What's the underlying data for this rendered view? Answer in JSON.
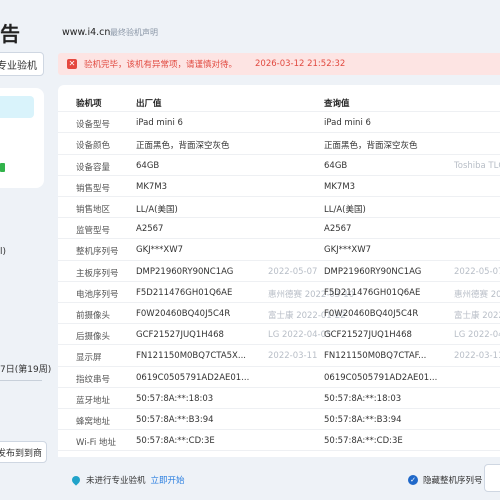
{
  "left": {
    "title_char": "告",
    "pro_button": "专业验机",
    "text_1": "l)",
    "text_2": "7日(第19周)",
    "bottom_button": "发布到到商"
  },
  "header": {
    "site": "www.i4.cn",
    "disclaimer": "最终验机声明"
  },
  "alert": {
    "message": "验机完毕，该机有异常项，请谨慎对待。",
    "time": "2026-03-12 21:52:32",
    "color": "#e14a40"
  },
  "table": {
    "headers": {
      "label": "验机项",
      "factory": "出厂值",
      "query": "查询值"
    },
    "rows": [
      {
        "label": "设备型号",
        "factory": "iPad mini 6",
        "fdate": "",
        "query": "iPad mini 6",
        "qdate": ""
      },
      {
        "label": "设备颜色",
        "factory": "正面黑色，背面深空灰色",
        "fdate": "",
        "query": "正面黑色，背面深空灰色",
        "qdate": ""
      },
      {
        "label": "设备容量",
        "factory": "64GB",
        "fdate": "",
        "query": "64GB",
        "qdate": "Toshiba TLC"
      },
      {
        "label": "销售型号",
        "factory": "MK7M3",
        "fdate": "",
        "query": "MK7M3",
        "qdate": ""
      },
      {
        "label": "销售地区",
        "factory": "LL/A(美国)",
        "fdate": "",
        "query": "LL/A(美国)",
        "qdate": ""
      },
      {
        "label": "监管型号",
        "factory": "A2567",
        "fdate": "",
        "query": "A2567",
        "qdate": ""
      },
      {
        "label": "整机序列号",
        "factory": "GKJ***XW7",
        "fdate": "",
        "query": "GKJ***XW7",
        "qdate": ""
      },
      {
        "label": "主板序列号",
        "factory": "DMP21960RY90NC1AG",
        "fdate": "2022-05-07",
        "query": "DMP21960RY90NC1AG",
        "qdate": "2022-05-07"
      },
      {
        "label": "电池序列号",
        "factory": "F5D211476GH01Q6AE",
        "fdate": "惠州德赛 2022-03-10",
        "query": "F5D211476GH01Q6AE",
        "qdate": "惠州德赛 2022-03-10"
      },
      {
        "label": "前摄像头",
        "factory": "F0W20460BQ40J5C4R",
        "fdate": "富士康 2022-01-22",
        "query": "F0W20460BQ40J5C4R",
        "qdate": "富士康 2022-01-22"
      },
      {
        "label": "后摄像头",
        "factory": "GCF21527JUQ1H468",
        "fdate": "LG 2022-04-05",
        "query": "GCF21527JUQ1H468",
        "qdate": "LG 2022-04-05"
      },
      {
        "label": "显示屏",
        "factory": "FN121150M0BQ7CTA5X...",
        "fdate": "2022-03-11",
        "query": "FN121150M0BQ7CTAF...",
        "qdate": "2022-03-11"
      },
      {
        "label": "指纹串号",
        "factory": "0619C0505791AD2AE01...",
        "fdate": "",
        "query": "0619C0505791AD2AE01...",
        "qdate": ""
      },
      {
        "label": "蓝牙地址",
        "factory": "50:57:8A:**:18:03",
        "fdate": "",
        "query": "50:57:8A:**:18:03",
        "qdate": ""
      },
      {
        "label": "蜂窝地址",
        "factory": "50:57:8A:**:B3:94",
        "fdate": "",
        "query": "50:57:8A:**:B3:94",
        "qdate": ""
      },
      {
        "label": "Wi-Fi 地址",
        "factory": "50:57:8A:**:CD:3E",
        "fdate": "",
        "query": "50:57:8A:**:CD:3E",
        "qdate": ""
      }
    ]
  },
  "footer": {
    "pro_status": "未进行专业验机",
    "start_link": "立即开始",
    "hide_serial": "隐藏整机序列号"
  }
}
